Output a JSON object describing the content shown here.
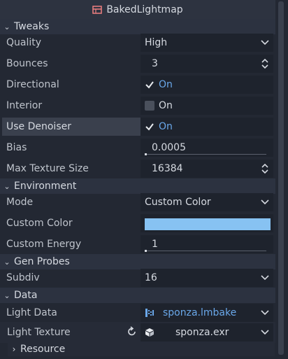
{
  "title": "BakedLightmap",
  "sections": {
    "tweaks": "Tweaks",
    "environment": "Environment",
    "gen_probes": "Gen Probes",
    "data": "Data"
  },
  "props": {
    "quality": {
      "label": "Quality",
      "value": "High"
    },
    "bounces": {
      "label": "Bounces",
      "value": "3"
    },
    "directional": {
      "label": "Directional",
      "value": "On"
    },
    "interior": {
      "label": "Interior",
      "value": "On"
    },
    "use_denoiser": {
      "label": "Use Denoiser",
      "value": "On"
    },
    "bias": {
      "label": "Bias",
      "value": "0.0005"
    },
    "max_texture_size": {
      "label": "Max Texture Size",
      "value": "16384"
    },
    "mode": {
      "label": "Mode",
      "value": "Custom Color"
    },
    "custom_color": {
      "label": "Custom Color",
      "color": "#87c2f2"
    },
    "custom_energy": {
      "label": "Custom Energy",
      "value": "1"
    },
    "subdiv": {
      "label": "Subdiv",
      "value": "16"
    },
    "light_data": {
      "label": "Light Data",
      "value": "sponza.lmbake"
    },
    "light_texture": {
      "label": "Light Texture",
      "value": "sponza.exr"
    }
  },
  "resource": "Resource",
  "colors": {
    "accent": "#6aa8ea",
    "swatch": "#87c2f2"
  }
}
